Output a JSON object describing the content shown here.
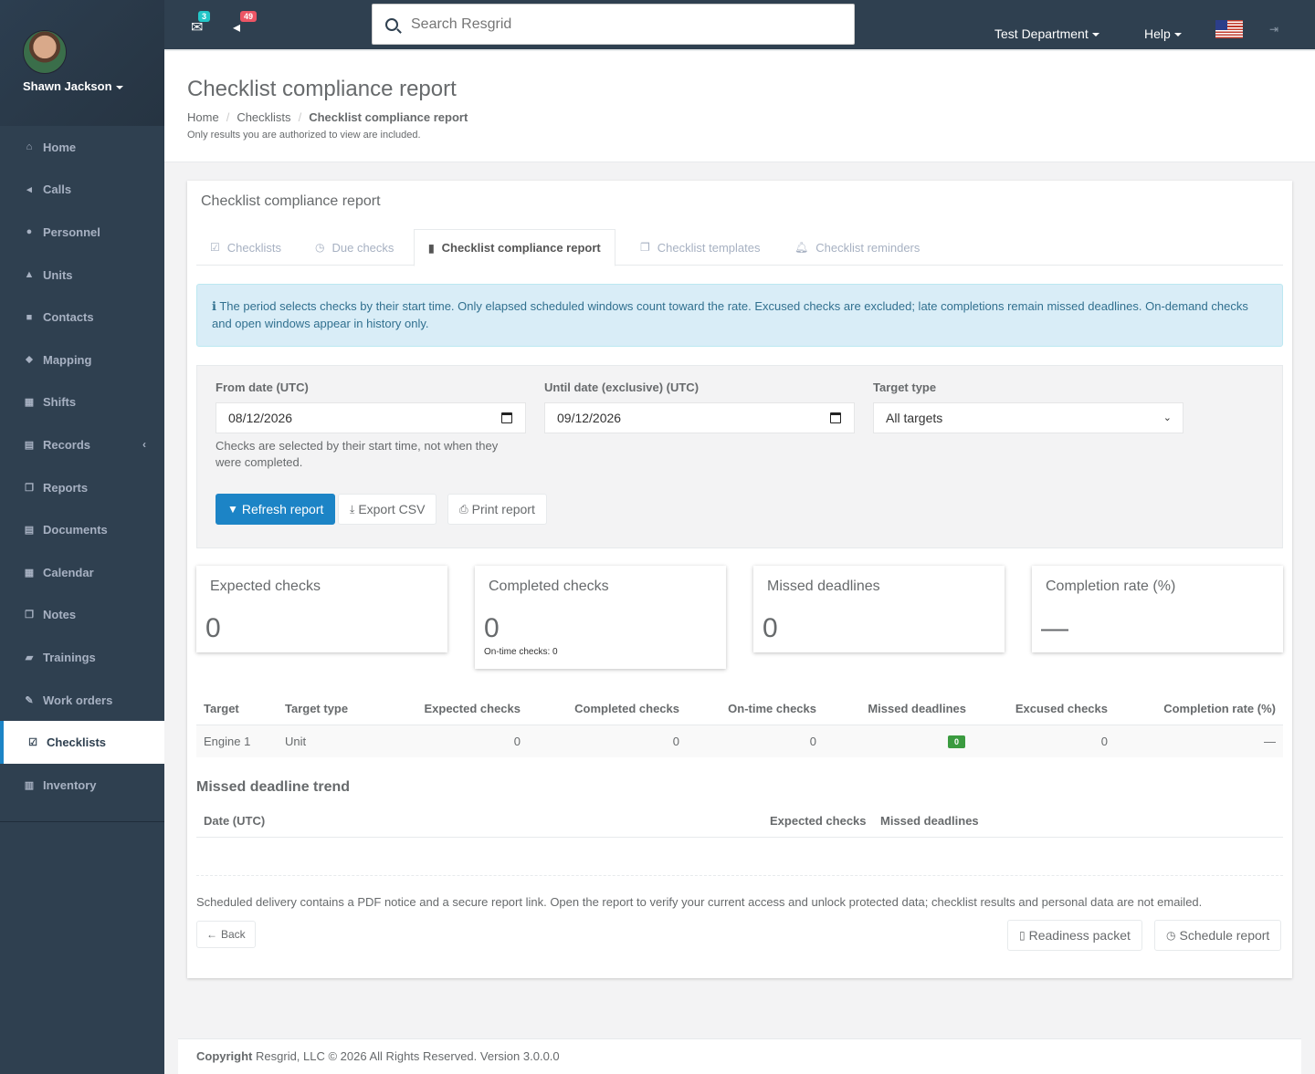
{
  "user": {
    "name": "Shawn Jackson"
  },
  "sidebar": {
    "items": [
      {
        "label": "Home",
        "icon": "home-icon",
        "glyph": "⌂"
      },
      {
        "label": "Calls",
        "icon": "bullhorn-icon",
        "glyph": "◂"
      },
      {
        "label": "Personnel",
        "icon": "user-icon",
        "glyph": "●"
      },
      {
        "label": "Units",
        "icon": "road-icon",
        "glyph": "▲"
      },
      {
        "label": "Contacts",
        "icon": "address-book-icon",
        "glyph": "■"
      },
      {
        "label": "Mapping",
        "icon": "map-marker-icon",
        "glyph": "⬥"
      },
      {
        "label": "Shifts",
        "icon": "cubes-icon",
        "glyph": "▦"
      },
      {
        "label": "Records",
        "icon": "file-icon",
        "glyph": "▤"
      },
      {
        "label": "Reports",
        "icon": "copy-icon",
        "glyph": "❐"
      },
      {
        "label": "Documents",
        "icon": "file-text-icon",
        "glyph": "▤"
      },
      {
        "label": "Calendar",
        "icon": "calendar-icon",
        "glyph": "▦"
      },
      {
        "label": "Notes",
        "icon": "files-icon",
        "glyph": "❐"
      },
      {
        "label": "Trainings",
        "icon": "book-icon",
        "glyph": "▰"
      },
      {
        "label": "Work orders",
        "icon": "wrench-icon",
        "glyph": "✎"
      },
      {
        "label": "Checklists",
        "icon": "check-square-icon",
        "glyph": "☑"
      },
      {
        "label": "Inventory",
        "icon": "barcode-icon",
        "glyph": "▥"
      }
    ]
  },
  "topbar": {
    "mail_badge": "3",
    "alerts_badge": "49",
    "search_placeholder": "Search Resgrid",
    "department": "Test Department",
    "help": "Help"
  },
  "heading": {
    "title": "Checklist compliance report",
    "breadcrumbs": [
      "Home",
      "Checklists",
      "Checklist compliance report"
    ],
    "note": "Only results you are authorized to view are included."
  },
  "panel": {
    "title": "Checklist compliance report",
    "tabs": [
      "Checklists",
      "Due checks",
      "Checklist compliance report",
      "Checklist templates",
      "Checklist reminders"
    ],
    "info": "The period selects checks by their start time. Only elapsed scheduled windows count toward the rate. Excused checks are excluded; late completions remain missed deadlines. On-demand checks and open windows appear in history only."
  },
  "filters": {
    "from_label": "From date (UTC)",
    "from_value": "08/12/2026",
    "until_label": "Until date (exclusive) (UTC)",
    "until_value": "09/12/2026",
    "target_label": "Target type",
    "target_value": "All targets",
    "help": "Checks are selected by their start time, not when they were completed.",
    "refresh": "Refresh report",
    "export": "Export CSV",
    "print": "Print report"
  },
  "summary": {
    "expected_label": "Expected checks",
    "expected_value": "0",
    "completed_label": "Completed checks",
    "completed_value": "0",
    "ontime_note": "On-time checks: 0",
    "missed_label": "Missed deadlines",
    "missed_value": "0",
    "rate_label": "Completion rate (%)",
    "rate_value": "—"
  },
  "results": {
    "headers": [
      "Target",
      "Target type",
      "Expected checks",
      "Completed checks",
      "On-time checks",
      "Missed deadlines",
      "Excused checks",
      "Completion rate (%)"
    ],
    "rows": [
      [
        "Engine 1",
        "Unit",
        "0",
        "0",
        "0",
        "0",
        "0",
        "—"
      ]
    ]
  },
  "trend": {
    "title": "Missed deadline trend",
    "headers": [
      "Date (UTC)",
      "Expected checks",
      "Missed deadlines"
    ]
  },
  "footer_note": "Scheduled delivery contains a PDF notice and a secure report link. Open the report to verify your current access and unlock protected data; checklist results and personal data are not emailed.",
  "actions": {
    "back": "Back",
    "packet": "Readiness packet",
    "schedule": "Schedule report"
  },
  "footer": {
    "copyright": "Copyright",
    "text": "Resgrid, LLC © 2026 All Rights Reserved.",
    "version": "Version 3.0.0.0"
  }
}
